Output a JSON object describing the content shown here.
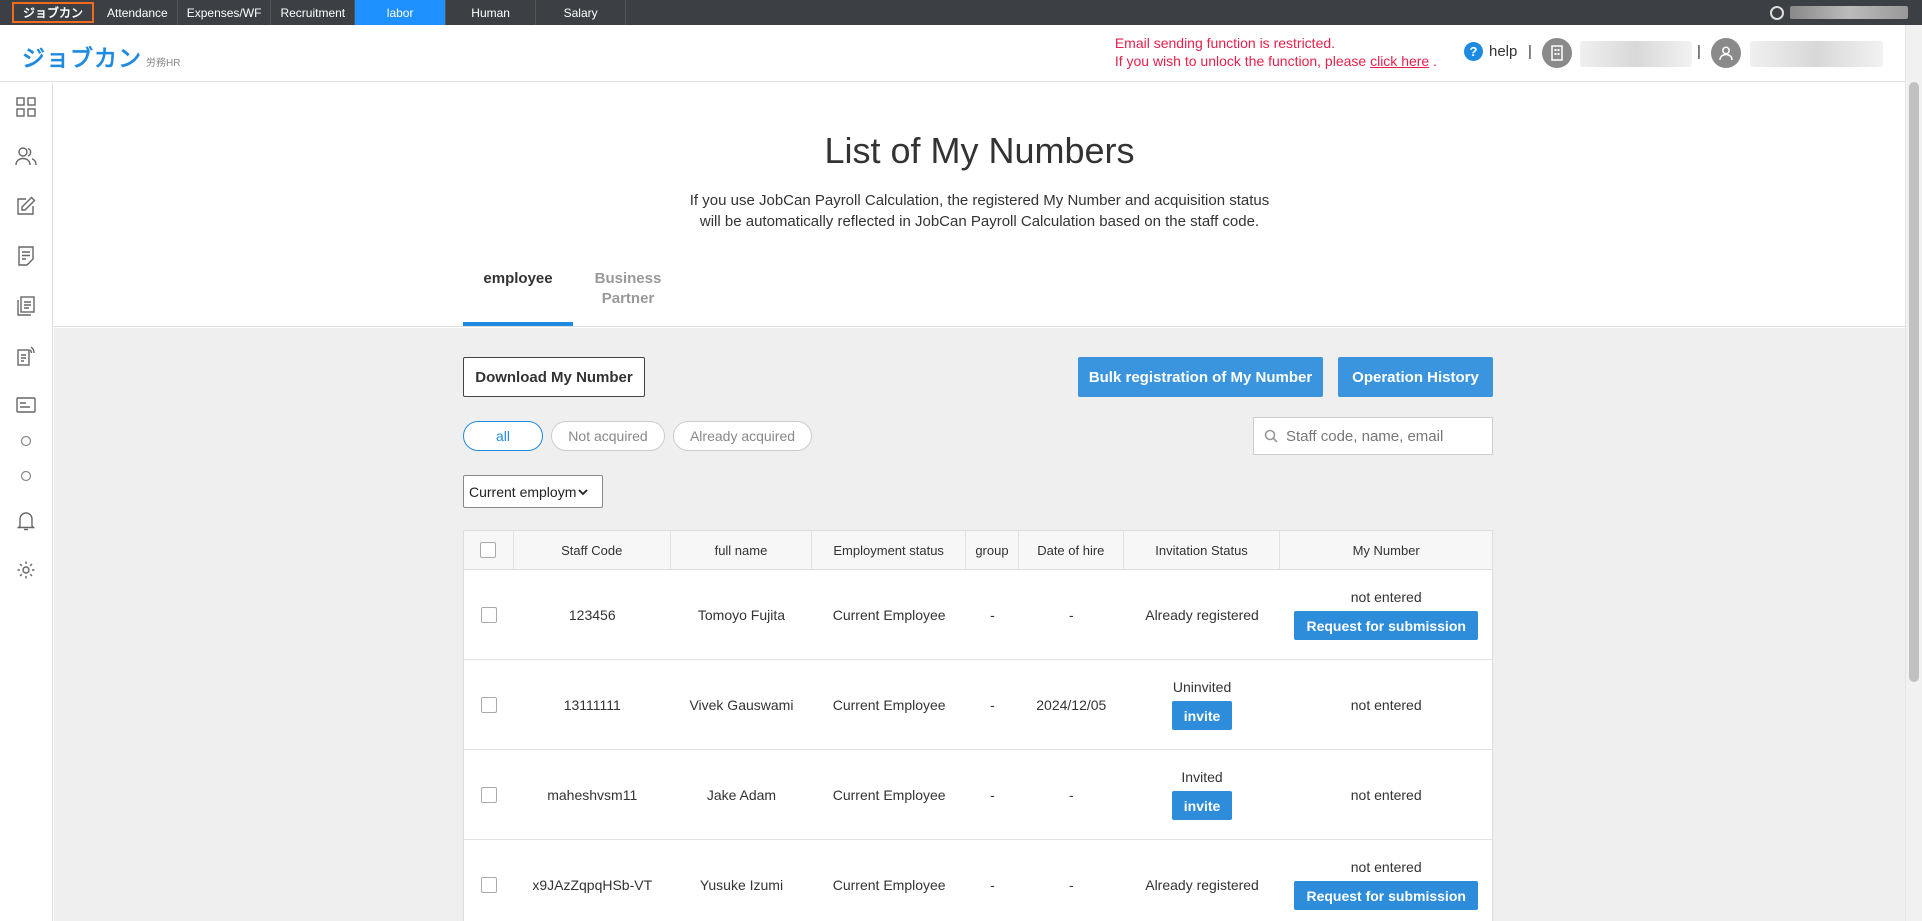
{
  "topbar": {
    "brand": "ジョブカン",
    "services": [
      "Attendance",
      "Expenses/WF",
      "Recruitment",
      "labor",
      "Human",
      "Salary"
    ],
    "active_service": "labor"
  },
  "header": {
    "logo_main": "ジョブカン",
    "logo_sub": "労務HR",
    "notice_line1": "Email sending function is restricted.",
    "notice_line2_prefix": "If you wish to unlock the function, please ",
    "notice_link": "click here",
    "notice_line2_suffix": " .",
    "help_label": "help",
    "separator": "|"
  },
  "page": {
    "title": "List of My Numbers",
    "desc_line1": "If you use JobCan Payroll Calculation, the registered My Number and acquisition status",
    "desc_line2": "will be automatically reflected in JobCan Payroll Calculation based on the staff code.",
    "tabs": [
      {
        "label": "employee",
        "active": true
      },
      {
        "label": "Business Partner",
        "active": false
      }
    ]
  },
  "toolbar": {
    "download_label": "Download My Number",
    "bulk_label": "Bulk registration of My Number",
    "history_label": "Operation History",
    "filters": [
      "all",
      "Not acquired",
      "Already acquired"
    ],
    "active_filter": "all",
    "search_placeholder": "Staff code, name, email",
    "employment_select": "Current employm"
  },
  "table": {
    "headers": [
      "Staff Code",
      "full name",
      "Employment status",
      "group",
      "Date of hire",
      "Invitation Status",
      "My Number"
    ],
    "rows": [
      {
        "code": "123456",
        "name": "Tomoyo Fujita",
        "status": "Current Employee",
        "group": "-",
        "hire": "-",
        "invitation": "Already registered",
        "invite_button": "",
        "my_number": "not entered",
        "my_number_button": "Request for submission"
      },
      {
        "code": "13111111",
        "name": "Vivek Gauswami",
        "status": "Current Employee",
        "group": "-",
        "hire": "2024/12/05",
        "invitation": "Uninvited",
        "invite_button": "invite",
        "my_number": "not entered",
        "my_number_button": ""
      },
      {
        "code": "maheshvsm11",
        "name": "Jake Adam",
        "status": "Current Employee",
        "group": "-",
        "hire": "-",
        "invitation": "Invited",
        "invite_button": "invite",
        "my_number": "not entered",
        "my_number_button": ""
      },
      {
        "code": "x9JAzZqpqHSb-VT",
        "name": "Yusuke Izumi",
        "status": "Current Employee",
        "group": "-",
        "hire": "-",
        "invitation": "Already registered",
        "invite_button": "",
        "my_number": "not entered",
        "my_number_button": "Request for submission"
      }
    ]
  },
  "sidebar": {
    "icons": [
      "dashboard-icon",
      "people-icon",
      "edit-icon",
      "document-icon",
      "files-icon",
      "form-icon",
      "card-icon",
      "circle-icon",
      "circle-icon",
      "bell-icon",
      "gear-icon"
    ]
  },
  "colors": {
    "accent": "#1f8be0",
    "button_blue": "#3a95de",
    "notice_red": "#e5214c",
    "topbar_bg": "#3c4044",
    "brand_border": "#f26b1d"
  }
}
